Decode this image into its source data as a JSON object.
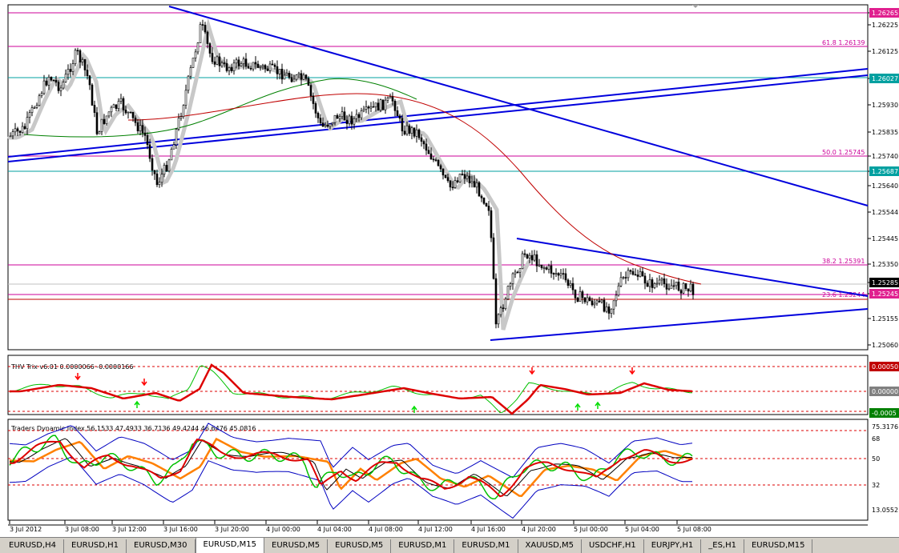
{
  "colors": {
    "bg": "#ffffff",
    "candle": "#000000",
    "shadow_line": "#c8c8c8",
    "ma_green": "#008000",
    "ma_red": "#c00000",
    "trend_blue": "#0000dd",
    "fib_magenta": "#cc0099",
    "level_cyan": "#00a0a0",
    "trix_green": "#00c000",
    "trix_red": "#dd0000",
    "tdi_blue": "#0000c0",
    "tdi_orange": "#ff8000",
    "arrow_red": "#ff0000",
    "arrow_green": "#00dd00"
  },
  "price_panel": {
    "price_labels": [
      "1.26265",
      "1.26225",
      "1.26125",
      "1.26027",
      "1.25930",
      "1.25835",
      "1.25740",
      "1.25687",
      "1.25640",
      "1.25544",
      "1.25445",
      "1.25350",
      "1.25285",
      "1.25245",
      "1.25155",
      "1.25060"
    ],
    "badges": [
      {
        "text": "1.26265",
        "color": "#e0208f"
      },
      {
        "text": "1.26027",
        "color": "#00a0a0"
      },
      {
        "text": "1.25687",
        "color": "#00a0a0"
      },
      {
        "text": "1.25285",
        "color": "#000000"
      },
      {
        "text": "1.25245",
        "color": "#e0208f"
      }
    ],
    "fib_labels": [
      "61.8 1.26139",
      "50.0 1.25745",
      "38.2 1.25391",
      "23.6 1.25244"
    ]
  },
  "trix_panel": {
    "title": "THV Trix v6.01 0.0000066 -0.0000166",
    "price_labels": [
      "0.00050",
      "0.00000",
      "-0.0005"
    ]
  },
  "tdi_panel": {
    "title": "Traders Dynamic Index 56.1533 47.4933 36.7136 49.4244 46.6476 45.0816",
    "price_labels": [
      "75.3176",
      "68",
      "50",
      "32",
      "13.0552"
    ]
  },
  "time_labels": [
    "3 Jul 2012",
    "3 Jul 08:00",
    "3 Jul 12:00",
    "3 Jul 16:00",
    "3 Jul 20:00",
    "4 Jul 00:00",
    "4 Jul 04:00",
    "4 Jul 08:00",
    "4 Jul 12:00",
    "4 Jul 16:00",
    "4 Jul 20:00",
    "5 Jul 00:00",
    "5 Jul 04:00",
    "5 Jul 08:00"
  ],
  "tabs": [
    "EURUSD,H4",
    "EURUSD,H1",
    "EURUSD,M30",
    "EURUSD,M15",
    "EURUSD,M5",
    "EURUSD,M5",
    "EURUSD,M1",
    "EURUSD,M1",
    "XAUUSD,M5",
    "USDCHF,H1",
    "EURJPY,H1",
    "_ES,H1",
    "EURUSD,M15"
  ],
  "active_tab": 3
}
